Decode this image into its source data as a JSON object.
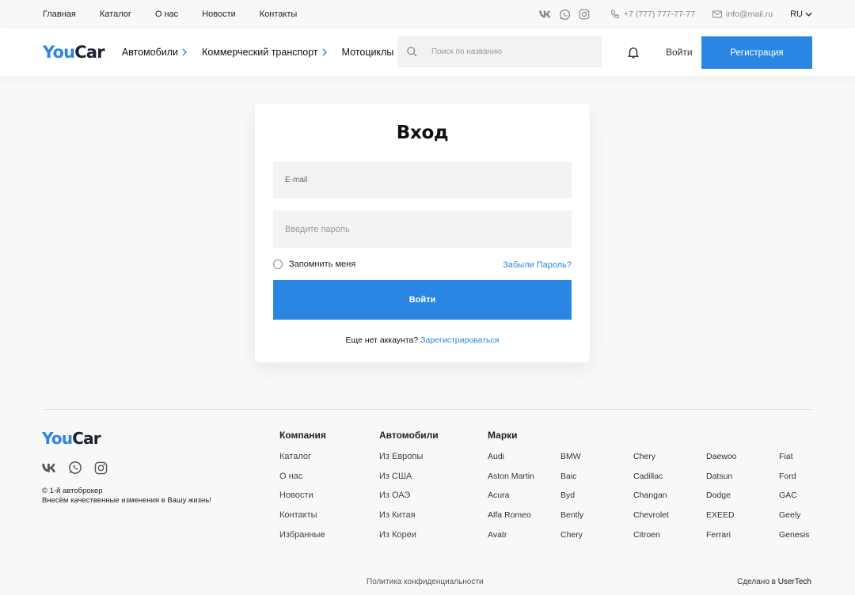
{
  "topbar": {
    "nav": [
      "Главная",
      "Каталог",
      "О нас",
      "Новости",
      "Контакты"
    ],
    "phone": "+7 (777) 777-77-77",
    "email": "info@mail.ru",
    "language": "RU"
  },
  "header": {
    "logo_you": "You",
    "logo_car": "Car",
    "nav": [
      "Автомобили",
      "Коммерческий транспорт",
      "Мотоциклы"
    ],
    "search_placeholder": "Поиск по названию",
    "login_label": "Войти",
    "register_label": "Регистрация"
  },
  "login": {
    "title": "Вход",
    "email_placeholder": "E-mail",
    "password_placeholder": "Введите пароль",
    "remember_label": "Запомнить меня",
    "forgot_label": "Забыли Пароль?",
    "submit_label": "Войти",
    "no_account_text": "Еще нет аккаунта?",
    "register_link": "Зарегистрироваться"
  },
  "footer": {
    "logo_you": "You",
    "logo_car": "Car",
    "copyright": "© 1-й автоброкер",
    "slogan": "Внесём качественные изменения в Вашу жизнь!",
    "company": {
      "title": "Компания",
      "items": [
        "Каталог",
        "О нас",
        "Новости",
        "Контакты",
        "Избранные"
      ]
    },
    "cars": {
      "title": "Автомобили",
      "items": [
        "Из Европы",
        "Из США",
        "Из ОАЭ",
        "Из Китая",
        "Из Кореи"
      ]
    },
    "brands": {
      "title": "Марки",
      "items": [
        "Audi",
        "BMW",
        "Chery",
        "Daewoo",
        "Fiat",
        "Aston Martin",
        "Baic",
        "Cadillac",
        "Datsun",
        "Ford",
        "Acura",
        "Byd",
        "Changan",
        "Dodge",
        "GAC",
        "Alfa Romeo",
        "Bently",
        "Chevrolet",
        "EXEED",
        "Geely",
        "Avatr",
        "Chery",
        "Citroen",
        "Ferrari",
        "Genesis"
      ]
    },
    "privacy": "Политика конфиденциальности",
    "made_by_prefix": "Сделано в",
    "made_by_brand": "UserTech"
  },
  "colors": {
    "accent": "#2b86e3",
    "logo_dark": "#1a2332",
    "background": "#f8f8f8"
  }
}
